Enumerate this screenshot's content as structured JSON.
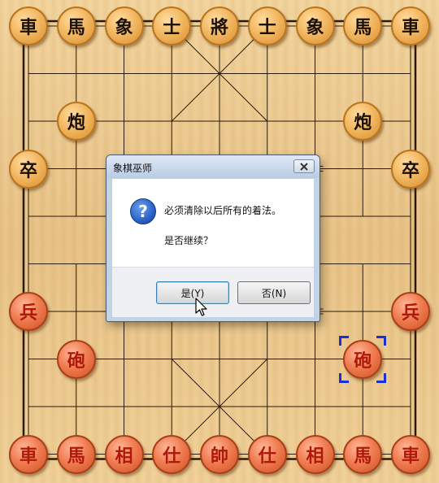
{
  "board": {
    "colors": {
      "line": "#2a1a0a",
      "black_piece": "#f2b862",
      "red_piece": "#f07d52",
      "selection": "#1a2fd8"
    },
    "pieces": [
      {
        "label": "車",
        "side": "black",
        "col": 0,
        "row": 0
      },
      {
        "label": "馬",
        "side": "black",
        "col": 1,
        "row": 0
      },
      {
        "label": "象",
        "side": "black",
        "col": 2,
        "row": 0
      },
      {
        "label": "士",
        "side": "black",
        "col": 3,
        "row": 0
      },
      {
        "label": "將",
        "side": "black",
        "col": 4,
        "row": 0
      },
      {
        "label": "士",
        "side": "black",
        "col": 5,
        "row": 0
      },
      {
        "label": "象",
        "side": "black",
        "col": 6,
        "row": 0
      },
      {
        "label": "馬",
        "side": "black",
        "col": 7,
        "row": 0
      },
      {
        "label": "車",
        "side": "black",
        "col": 8,
        "row": 0
      },
      {
        "label": "炮",
        "side": "black",
        "col": 1,
        "row": 2
      },
      {
        "label": "炮",
        "side": "black",
        "col": 7,
        "row": 2
      },
      {
        "label": "卒",
        "side": "black",
        "col": 0,
        "row": 3
      },
      {
        "label": "卒",
        "side": "black",
        "col": 8,
        "row": 3
      },
      {
        "label": "兵",
        "side": "red",
        "col": 0,
        "row": 6
      },
      {
        "label": "兵",
        "side": "red",
        "col": 8,
        "row": 6
      },
      {
        "label": "砲",
        "side": "red",
        "col": 1,
        "row": 7
      },
      {
        "label": "砲",
        "side": "red",
        "col": 7,
        "row": 7,
        "selected": true
      },
      {
        "label": "車",
        "side": "red",
        "col": 0,
        "row": 9
      },
      {
        "label": "馬",
        "side": "red",
        "col": 1,
        "row": 9
      },
      {
        "label": "相",
        "side": "red",
        "col": 2,
        "row": 9
      },
      {
        "label": "仕",
        "side": "red",
        "col": 3,
        "row": 9
      },
      {
        "label": "帥",
        "side": "red",
        "col": 4,
        "row": 9
      },
      {
        "label": "仕",
        "side": "red",
        "col": 5,
        "row": 9
      },
      {
        "label": "相",
        "side": "red",
        "col": 6,
        "row": 9
      },
      {
        "label": "馬",
        "side": "red",
        "col": 7,
        "row": 9
      },
      {
        "label": "車",
        "side": "red",
        "col": 8,
        "row": 9
      }
    ]
  },
  "dialog": {
    "title": "象棋巫师",
    "message_line1": "必须清除以后所有的着法。",
    "message_line2": "是否继续？",
    "icon": "question-icon",
    "yes_label": "是(Y)",
    "no_label": "否(N)"
  }
}
